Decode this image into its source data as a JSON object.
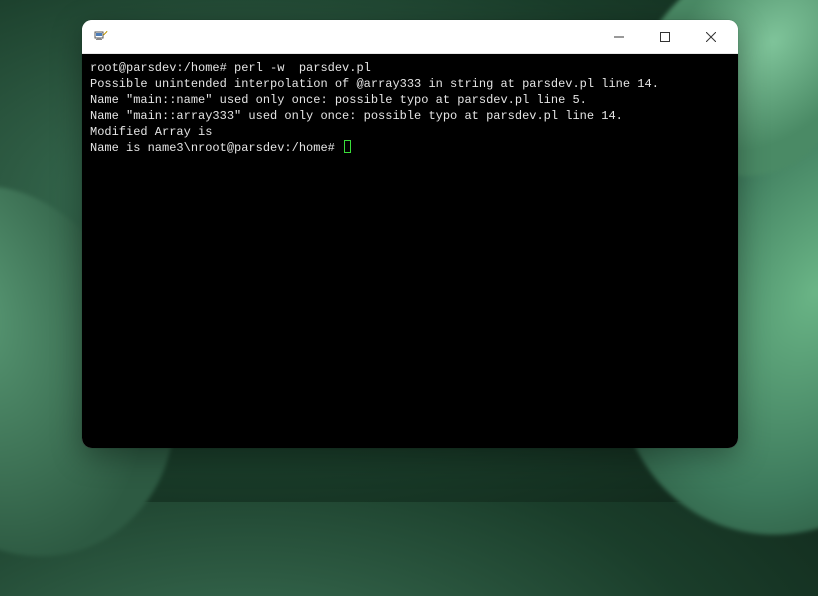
{
  "window": {
    "title": ""
  },
  "terminal": {
    "prompt1": "root@parsdev:/home# ",
    "command1": "perl -w  parsdev.pl",
    "output": [
      "Possible unintended interpolation of @array333 in string at parsdev.pl line 14.",
      "Name \"main::name\" used only once: possible typo at parsdev.pl line 5.",
      "Name \"main::array333\" used only once: possible typo at parsdev.pl line 14.",
      "Modified Array is",
      "Name is name3\\nroot@parsdev:/home# "
    ]
  },
  "controls": {
    "minimize": "minimize",
    "maximize": "maximize",
    "close": "close"
  }
}
